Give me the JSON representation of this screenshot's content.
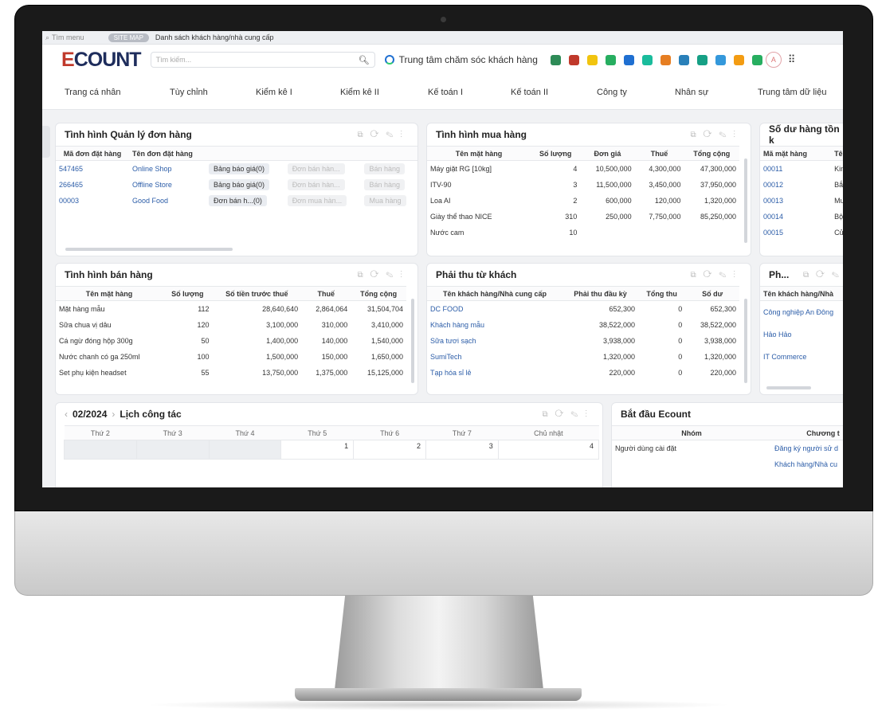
{
  "topbar": {
    "menu_placeholder": "Tìm menu",
    "site_map": "SITE MAP",
    "breadcrumb": "Danh sách khách hàng/nhà cung cấp"
  },
  "header": {
    "logo": "ECOUNT",
    "search_placeholder": "Tìm kiếm...",
    "customer_center": "Trung tâm chăm sóc khách hàng",
    "avatar": "A",
    "icon_colors": [
      "#2e8b57",
      "#c0392b",
      "#f1c40f",
      "#27ae60",
      "#1f6fd1",
      "#1abc9c",
      "#e67e22",
      "#2980b9",
      "#16a085",
      "#3498db",
      "#f39c12",
      "#27ae60"
    ]
  },
  "nav": [
    "Trang cá nhân",
    "Tùy chỉnh",
    "Kiểm kê I",
    "Kiểm kê II",
    "Kế toán I",
    "Kế toán II",
    "Công ty",
    "Nhân sự",
    "Trung tâm dữ liệu"
  ],
  "orders": {
    "title": "Tình hình Quản lý đơn hàng",
    "headers": [
      "Mã đơn đặt hàng",
      "Tên đơn đặt hàng"
    ],
    "rows": [
      [
        "547465",
        "Online Shop",
        "Bảng báo giá(0)",
        "Đơn bán hàn...",
        "Bán hàng"
      ],
      [
        "266465",
        "Offline Store",
        "Bảng báo giá(0)",
        "Đơn bán hàn...",
        "Bán hàng"
      ],
      [
        "00003",
        "Good Food",
        "Đơn bán h...(0)",
        "Đơn mua hàn...",
        "Mua hàng"
      ]
    ]
  },
  "purchase": {
    "title": "Tình hình mua hàng",
    "headers": [
      "Tên mặt hàng",
      "Số lượng",
      "Đơn giá",
      "Thuế",
      "Tổng cộng"
    ],
    "rows": [
      [
        "Máy giặt RG [10kg]",
        "4",
        "10,500,000",
        "4,300,000",
        "47,300,000"
      ],
      [
        "ITV-90",
        "3",
        "11,500,000",
        "3,450,000",
        "37,950,000"
      ],
      [
        "Loa AI",
        "2",
        "600,000",
        "120,000",
        "1,320,000"
      ],
      [
        "Giày thể thao NICE",
        "310",
        "250,000",
        "7,750,000",
        "85,250,000"
      ],
      [
        "Nước cam",
        "10",
        "",
        "",
        ""
      ]
    ]
  },
  "stock": {
    "title": "Số dư hàng tồn k",
    "headers": [
      "Mã mặt hàng",
      "Tên m"
    ],
    "rows": [
      [
        "00011",
        "Kim ch"
      ],
      [
        "00012",
        "Bắp cả"
      ],
      [
        "00013",
        "Muối"
      ],
      [
        "00014",
        "Bột ớt"
      ],
      [
        "00015",
        "Củ cải"
      ]
    ]
  },
  "sales": {
    "title": "Tình hình bán hàng",
    "headers": [
      "Tên mặt hàng",
      "Số lượng",
      "Số tiền trước thuế",
      "Thuế",
      "Tổng cộng"
    ],
    "rows": [
      [
        "Mặt hàng mẫu",
        "112",
        "28,640,640",
        "2,864,064",
        "31,504,704"
      ],
      [
        "Sữa chua vị dâu",
        "120",
        "3,100,000",
        "310,000",
        "3,410,000"
      ],
      [
        "Cá ngừ đóng hộp 300g",
        "50",
        "1,400,000",
        "140,000",
        "1,540,000"
      ],
      [
        "Nước chanh có ga 250ml",
        "100",
        "1,500,000",
        "150,000",
        "1,650,000"
      ],
      [
        "Set phụ kiện headset",
        "55",
        "13,750,000",
        "1,375,000",
        "15,125,000"
      ]
    ]
  },
  "receivable": {
    "title": "Phải thu từ khách",
    "headers": [
      "Tên khách hàng/Nhà cung cấp",
      "Phải thu đầu kỳ",
      "Tổng thu",
      "Số dư"
    ],
    "rows": [
      [
        "DC FOOD",
        "652,300",
        "0",
        "652,300"
      ],
      [
        "Khách hàng mẫu",
        "38,522,000",
        "0",
        "38,522,000"
      ],
      [
        "Sữa tươi sạch",
        "3,938,000",
        "0",
        "3,938,000"
      ],
      [
        "SumiTech",
        "1,320,000",
        "0",
        "1,320,000"
      ],
      [
        "Tạp hóa sỉ lẻ",
        "220,000",
        "0",
        "220,000"
      ]
    ]
  },
  "payable": {
    "title": "Ph...",
    "headers": [
      "Tên khách hàng/Nhà"
    ],
    "rows": [
      [
        "Công nghiệp An Đông"
      ],
      [
        "Hảo Hảo"
      ],
      [
        "IT Commerce"
      ]
    ]
  },
  "calendar": {
    "month": "02/2024",
    "title": "Lịch công tác",
    "days": [
      "Thứ 2",
      "Thứ 3",
      "Thứ 4",
      "Thứ 5",
      "Thứ 6",
      "Thứ 7",
      "Chủ nhật"
    ],
    "dates": [
      "",
      "",
      "",
      "1",
      "2",
      "3",
      "4"
    ]
  },
  "start": {
    "title": "Bắt đầu Ecount",
    "headers": [
      "Nhóm",
      "Chương t"
    ],
    "rows": [
      [
        "Người dùng cài đặt",
        "Đăng ký người sử d"
      ],
      [
        "",
        "Khách hàng/Nhà cu"
      ]
    ]
  }
}
